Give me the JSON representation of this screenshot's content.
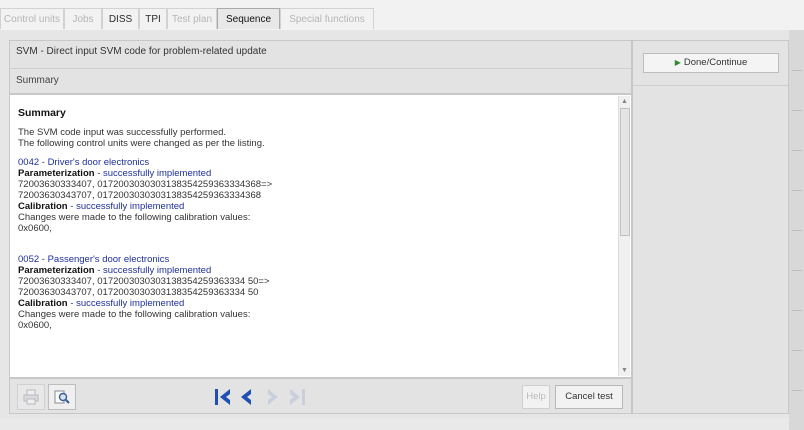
{
  "tabs": [
    {
      "label": "Control units",
      "state": "disabled"
    },
    {
      "label": "Jobs",
      "state": "disabled"
    },
    {
      "label": "DISS",
      "state": "enabled"
    },
    {
      "label": "TPI",
      "state": "enabled"
    },
    {
      "label": "Test plan",
      "state": "disabled"
    },
    {
      "label": "Sequence",
      "state": "selected"
    },
    {
      "label": "Special functions",
      "state": "disabled"
    }
  ],
  "header": {
    "title": "SVM - Direct input SVM code for problem-related update",
    "subtitle": "Summary"
  },
  "content": {
    "heading": "Summary",
    "intro": [
      "The SVM code input was successfully performed.",
      "The following control units were changed as per the listing."
    ],
    "units": [
      {
        "unit": "0042 - Driver's door electronics",
        "param_label": "Parameterization",
        "param_status": " - successfully implemented",
        "codes": [
          "72003630333407, 0172003030303138354259363334368=>",
          "72003630343707, 0172003030303138354259363334368"
        ],
        "calib_label": "Calibration",
        "calib_status": " - successfully implemented",
        "calib_text": "Changes were made to the following calibration values:",
        "calib_value": "0x0600,"
      },
      {
        "unit": "0052 - Passenger's door electronics",
        "param_label": "Parameterization",
        "param_status": " - successfully implemented",
        "codes": [
          "72003630333407, 0172003030303138354259363334 50=>",
          "72003630343707, 0172003030303138354259363334 50"
        ],
        "calib_label": "Calibration",
        "calib_status": " - successfully implemented",
        "calib_text": "Changes were made to the following calibration values:",
        "calib_value": "0x0600,"
      }
    ]
  },
  "footer": {
    "help_label": "Help",
    "cancel_label": "Cancel test"
  },
  "right_panel": {
    "continue_label": "Done/Continue"
  },
  "icons": {
    "print": "print-icon",
    "zoom": "magnifier-icon",
    "first": "first-page-icon",
    "prev": "previous-page-icon",
    "next": "next-page-icon",
    "last": "last-page-icon",
    "continue": "play-arrow-icon"
  },
  "colors": {
    "link_blue": "#1d2f9a",
    "nav_blue": "#1e50b4",
    "continue_green": "#2d8a2d"
  }
}
